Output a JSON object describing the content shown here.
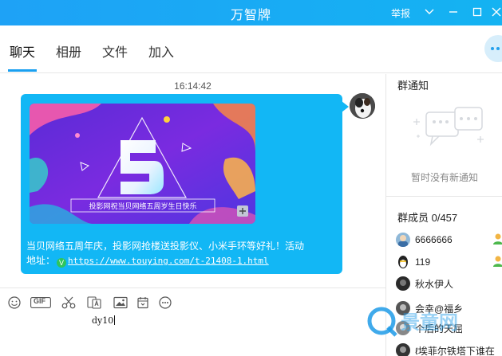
{
  "window": {
    "title": "万智牌",
    "report_label": "举报",
    "icons": [
      "chevron-down-icon",
      "minimize-icon",
      "maximize-icon",
      "close-icon"
    ]
  },
  "tabs": [
    {
      "label": "聊天",
      "active": true
    },
    {
      "label": "相册",
      "active": false
    },
    {
      "label": "文件",
      "active": false
    },
    {
      "label": "加入",
      "active": false
    }
  ],
  "chat": {
    "timestamp": "16:14:42",
    "message": {
      "banner_caption": "投影网祝当贝网络五周岁生日快乐",
      "text_line1": "当贝网络五周年庆，投影网抢楼送投影仪、小米手环等好礼！活动",
      "text_line2_prefix": "地址：",
      "link": "https://www.touying.com/t-21408-1.html",
      "bubble_color": "#12b7f5"
    }
  },
  "toolbar": {
    "gif_label": "GIF",
    "tools": [
      "emoji-icon",
      "gif-icon",
      "scissors-icon",
      "font-icon",
      "image-icon",
      "calendar-icon",
      "more-icon"
    ]
  },
  "input": {
    "value": "dy10"
  },
  "side": {
    "notice_title": "群通知",
    "notice_empty": "暂时没有新通知",
    "members_title": "群成员 0/457",
    "members": [
      {
        "name": "6666666"
      },
      {
        "name": "119"
      },
      {
        "name": "秋水伊人"
      },
      {
        "name": "会幸@福乡"
      },
      {
        "name": "个后的天屈"
      },
      {
        "name": "ℓ埃菲尔铁塔下谁在"
      }
    ]
  },
  "watermark": {
    "text": "景童网"
  },
  "colors": {
    "accent": "#1aa0f0",
    "titlebar": "#1ea2f6"
  }
}
